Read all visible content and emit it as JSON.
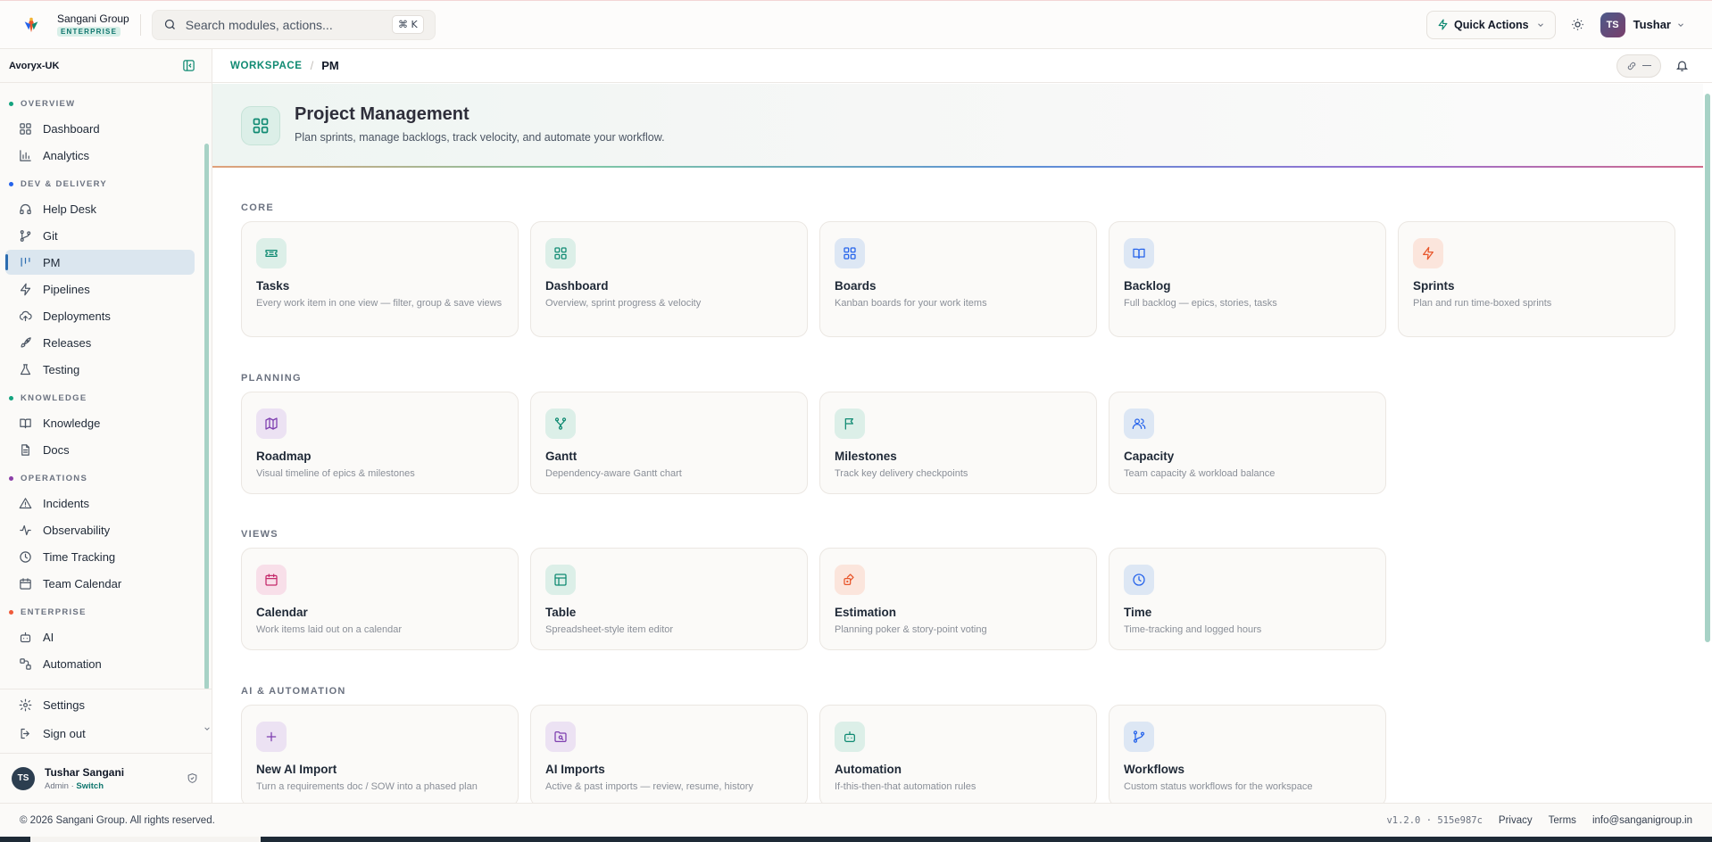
{
  "brand": {
    "name": "Sangani Group",
    "badge": "ENTERPRISE"
  },
  "search": {
    "placeholder": "Search modules, actions...",
    "shortcut": "⌘ K"
  },
  "topbar": {
    "quick_actions": "Quick Actions",
    "user_initials": "TS",
    "user_name": "Tushar"
  },
  "sidebar": {
    "org": "Avoryx-UK",
    "sections": [
      {
        "label": "OVERVIEW",
        "color": "#14a37f",
        "items": [
          {
            "label": "Dashboard",
            "icon": "grid-icon"
          },
          {
            "label": "Analytics",
            "icon": "bar-chart-icon"
          }
        ]
      },
      {
        "label": "DEV & DELIVERY",
        "color": "#2563eb",
        "items": [
          {
            "label": "Help Desk",
            "icon": "headphones-icon"
          },
          {
            "label": "Git",
            "icon": "git-branch-icon"
          },
          {
            "label": "PM",
            "icon": "kanban-icon",
            "active": true
          },
          {
            "label": "Pipelines",
            "icon": "lightning-icon"
          },
          {
            "label": "Deployments",
            "icon": "cloud-upload-icon"
          },
          {
            "label": "Releases",
            "icon": "rocket-icon"
          },
          {
            "label": "Testing",
            "icon": "flask-icon"
          }
        ]
      },
      {
        "label": "KNOWLEDGE",
        "color": "#14a37f",
        "items": [
          {
            "label": "Knowledge",
            "icon": "book-open-icon"
          },
          {
            "label": "Docs",
            "icon": "document-icon"
          }
        ]
      },
      {
        "label": "OPERATIONS",
        "color": "#8b3fa8",
        "items": [
          {
            "label": "Incidents",
            "icon": "warning-icon"
          },
          {
            "label": "Observability",
            "icon": "activity-icon"
          },
          {
            "label": "Time Tracking",
            "icon": "clock-icon"
          },
          {
            "label": "Team Calendar",
            "icon": "calendar-icon"
          }
        ]
      },
      {
        "label": "ENTERPRISE",
        "color": "#ef5a3a",
        "items": [
          {
            "label": "AI",
            "icon": "bot-icon"
          },
          {
            "label": "Automation",
            "icon": "workflow-icon"
          }
        ]
      }
    ],
    "bottom": [
      {
        "label": "Settings",
        "icon": "gear-icon"
      },
      {
        "label": "Sign out",
        "icon": "sign-out-icon"
      }
    ],
    "profile": {
      "initials": "TS",
      "name": "Tushar Sangani",
      "role": "Admin",
      "sep": " · ",
      "switch": "Switch"
    }
  },
  "breadcrumb": {
    "root": "WORKSPACE",
    "sep": "/",
    "current": "PM"
  },
  "hero": {
    "title": "Project Management",
    "subtitle": "Plan sprints, manage backlogs, track velocity, and automate your workflow."
  },
  "groups": [
    {
      "label": "CORE",
      "cards": [
        {
          "title": "Tasks",
          "desc": "Every work item in one view — filter, group & save views",
          "icon": "ticket-icon",
          "color": "#0f8a72",
          "bg": "#dcefe8"
        },
        {
          "title": "Dashboard",
          "desc": "Overview, sprint progress & velocity",
          "icon": "grid-icon",
          "color": "#0f8a72",
          "bg": "#dcefe8"
        },
        {
          "title": "Boards",
          "desc": "Kanban boards for your work items",
          "icon": "grid-icon",
          "color": "#2563eb",
          "bg": "#dde7f4"
        },
        {
          "title": "Backlog",
          "desc": "Full backlog — epics, stories, tasks",
          "icon": "book-open-icon",
          "color": "#2563eb",
          "bg": "#dde7f4"
        },
        {
          "title": "Sprints",
          "desc": "Plan and run time-boxed sprints",
          "icon": "lightning-icon",
          "color": "#e8572c",
          "bg": "#fbe5dc"
        }
      ]
    },
    {
      "label": "PLANNING",
      "cards": [
        {
          "title": "Roadmap",
          "desc": "Visual timeline of epics & milestones",
          "icon": "map-icon",
          "color": "#7e3fb0",
          "bg": "#ece2f3"
        },
        {
          "title": "Gantt",
          "desc": "Dependency-aware Gantt chart",
          "icon": "git-fork-icon",
          "color": "#0f8a72",
          "bg": "#dcefe8"
        },
        {
          "title": "Milestones",
          "desc": "Track key delivery checkpoints",
          "icon": "flag-icon",
          "color": "#0f8a72",
          "bg": "#dcefe8"
        },
        {
          "title": "Capacity",
          "desc": "Team capacity & workload balance",
          "icon": "users-icon",
          "color": "#2563eb",
          "bg": "#dde7f4"
        }
      ]
    },
    {
      "label": "VIEWS",
      "cards": [
        {
          "title": "Calendar",
          "desc": "Work items laid out on a calendar",
          "icon": "calendar-icon",
          "color": "#c42a6b",
          "bg": "#f8dfe9"
        },
        {
          "title": "Table",
          "desc": "Spreadsheet-style item editor",
          "icon": "table-icon",
          "color": "#0f8a72",
          "bg": "#dcefe8"
        },
        {
          "title": "Estimation",
          "desc": "Planning poker & story-point voting",
          "icon": "dice-icon",
          "color": "#e8572c",
          "bg": "#fbe5dc"
        },
        {
          "title": "Time",
          "desc": "Time-tracking and logged hours",
          "icon": "clock-icon",
          "color": "#2563eb",
          "bg": "#dde7f4"
        }
      ]
    },
    {
      "label": "AI & AUTOMATION",
      "cards": [
        {
          "title": "New AI Import",
          "desc": "Turn a requirements doc / SOW into a phased plan",
          "icon": "plus-icon",
          "color": "#7e3fb0",
          "bg": "#ece2f3"
        },
        {
          "title": "AI Imports",
          "desc": "Active & past imports — review, resume, history",
          "icon": "folder-search-icon",
          "color": "#7e3fb0",
          "bg": "#ece2f3"
        },
        {
          "title": "Automation",
          "desc": "If-this-then-that automation rules",
          "icon": "bot-icon",
          "color": "#0f8a72",
          "bg": "#dcefe8"
        },
        {
          "title": "Workflows",
          "desc": "Custom status workflows for the workspace",
          "icon": "git-branch-icon",
          "color": "#2563eb",
          "bg": "#dde7f4"
        }
      ]
    }
  ],
  "footer": {
    "copyright": "© 2026 Sangani Group. All rights reserved.",
    "version": "v1.2.0 · 515e987c",
    "links": [
      "Privacy",
      "Terms",
      "info@sanganigroup.in"
    ]
  }
}
